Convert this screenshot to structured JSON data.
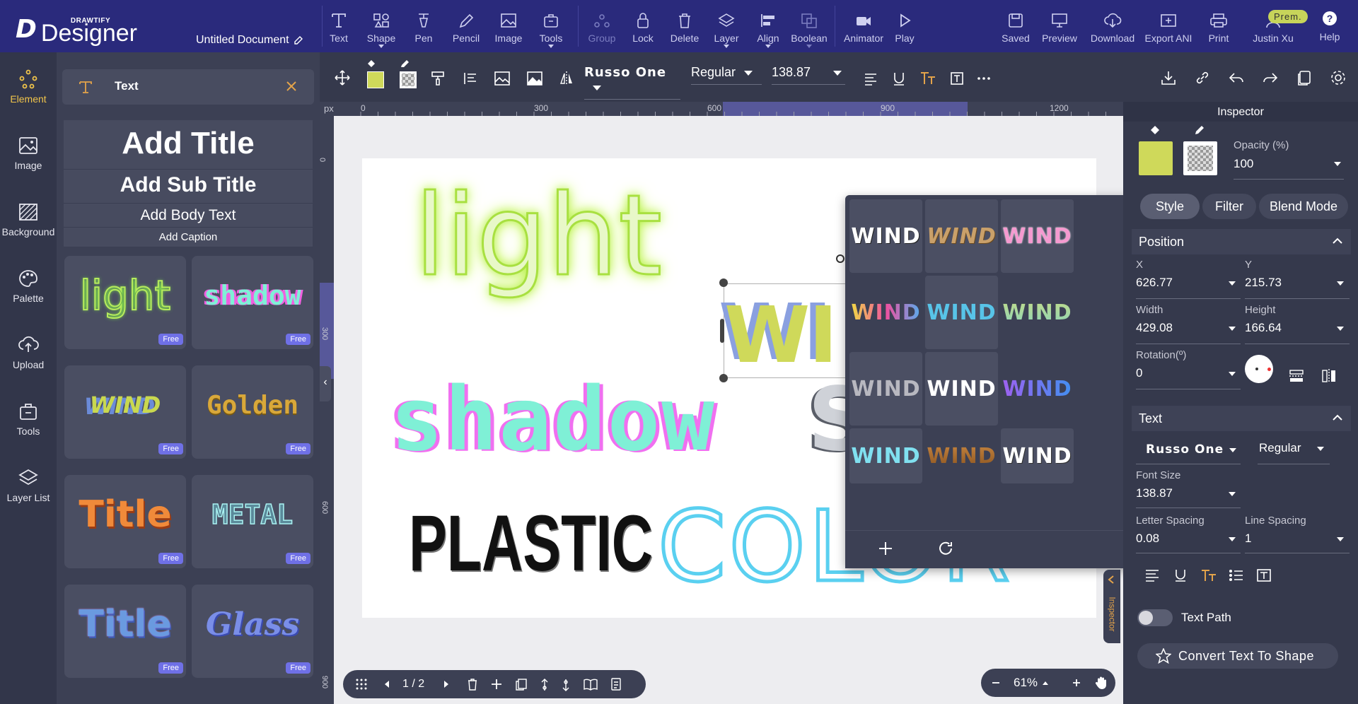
{
  "app": {
    "brand": "DRAWTIFY",
    "product": "Designer",
    "document_title": "Untitled Document"
  },
  "topbar": {
    "tools": [
      {
        "label": "Text",
        "icon": "text-icon"
      },
      {
        "label": "Shape",
        "icon": "shape-icon"
      },
      {
        "label": "Pen",
        "icon": "pen-icon"
      },
      {
        "label": "Pencil",
        "icon": "pencil-icon"
      },
      {
        "label": "Image",
        "icon": "image-icon"
      },
      {
        "label": "Tools",
        "icon": "tools-icon"
      },
      {
        "label": "Group",
        "icon": "group-icon"
      },
      {
        "label": "Lock",
        "icon": "lock-icon"
      },
      {
        "label": "Delete",
        "icon": "delete-icon"
      },
      {
        "label": "Layer",
        "icon": "layer-icon"
      },
      {
        "label": "Align",
        "icon": "align-icon"
      },
      {
        "label": "Boolean",
        "icon": "boolean-icon"
      },
      {
        "label": "Animator",
        "icon": "animator-icon"
      },
      {
        "label": "Play",
        "icon": "play-icon"
      }
    ],
    "right": [
      {
        "label": "Saved",
        "icon": "saved-icon"
      },
      {
        "label": "Preview",
        "icon": "preview-icon"
      },
      {
        "label": "Download",
        "icon": "download-icon"
      },
      {
        "label": "Export ANI",
        "icon": "export-icon"
      },
      {
        "label": "Print",
        "icon": "print-icon"
      }
    ],
    "user": {
      "name": "Justin Xu",
      "badge": "Prem."
    },
    "help": "Help"
  },
  "leftnav": [
    {
      "label": "Element",
      "icon": "element-icon"
    },
    {
      "label": "Image",
      "icon": "image-icon"
    },
    {
      "label": "Background",
      "icon": "background-icon"
    },
    {
      "label": "Palette",
      "icon": "palette-icon"
    },
    {
      "label": "Upload",
      "icon": "upload-icon"
    },
    {
      "label": "Tools",
      "icon": "tools-icon"
    },
    {
      "label": "Layer List",
      "icon": "layer-list-icon"
    }
  ],
  "panel": {
    "title": "Text",
    "add_title": "Add Title",
    "add_subtitle": "Add Sub Title",
    "add_body": "Add Body Text",
    "add_caption": "Add Caption",
    "free_badge": "Free",
    "cards": [
      {
        "text": "light",
        "style": "neon"
      },
      {
        "text": "shadow",
        "style": "glitch"
      },
      {
        "text": "WIND",
        "style": "wind"
      },
      {
        "text": "Golden",
        "style": "golden"
      },
      {
        "text": "Title",
        "style": "orange"
      },
      {
        "text": "METAL",
        "style": "metal"
      },
      {
        "text": "Title",
        "style": "gradient"
      },
      {
        "text": "Glass",
        "style": "glass"
      }
    ]
  },
  "toolbar": {
    "font": "Russo One",
    "weight": "Regular",
    "size": "138.87",
    "fill_color": "#cfd95a"
  },
  "ruler": {
    "unit": "px",
    "top_ticks": [
      "0",
      "300",
      "600",
      "900",
      "1200"
    ],
    "left_ticks": [
      "0",
      "300",
      "600",
      "900"
    ]
  },
  "canvas": {
    "texts": {
      "light": "light",
      "wind": "WI",
      "shadow": "shadow",
      "s": "S",
      "plastic": "PLASTIC",
      "color": "COLOR"
    }
  },
  "popover": {
    "cells": [
      {
        "label": "WIND",
        "style": "white"
      },
      {
        "label": "WIND",
        "style": "bronze"
      },
      {
        "label": "WIND",
        "style": "pink"
      },
      {
        "label": "WIND",
        "style": "rainbow"
      },
      {
        "label": "WIND",
        "style": "cyan"
      },
      {
        "label": "WIND",
        "style": "yellowgreen"
      },
      {
        "label": "WIND",
        "style": "grey"
      },
      {
        "label": "WIND",
        "style": "whitebold"
      },
      {
        "label": "WIND",
        "style": "blue"
      },
      {
        "label": "WIND",
        "style": "cyan2"
      },
      {
        "label": "WIND",
        "style": "copper"
      },
      {
        "label": "WIND",
        "style": "white2"
      }
    ]
  },
  "pager": {
    "page": "1 / 2"
  },
  "zoom": {
    "value": "61%"
  },
  "inspector": {
    "title": "Inspector",
    "opacity_label": "Opacity (%)",
    "opacity": "100",
    "tabs": [
      "Style",
      "Filter",
      "Blend Mode"
    ],
    "position_title": "Position",
    "x_label": "X",
    "x": "626.77",
    "y_label": "Y",
    "y": "215.73",
    "w_label": "Width",
    "w": "429.08",
    "h_label": "Height",
    "h": "166.64",
    "rot_label": "Rotation(º)",
    "rot": "0",
    "text_title": "Text",
    "font": "Russo One",
    "weight": "Regular",
    "fs_label": "Font Size",
    "fs": "138.87",
    "ls_label": "Letter Spacing",
    "ls": "0.08",
    "lns_label": "Line Spacing",
    "lns": "1",
    "text_path": "Text Path",
    "convert": "Convert Text To Shape",
    "side_tab": "Inspector"
  }
}
